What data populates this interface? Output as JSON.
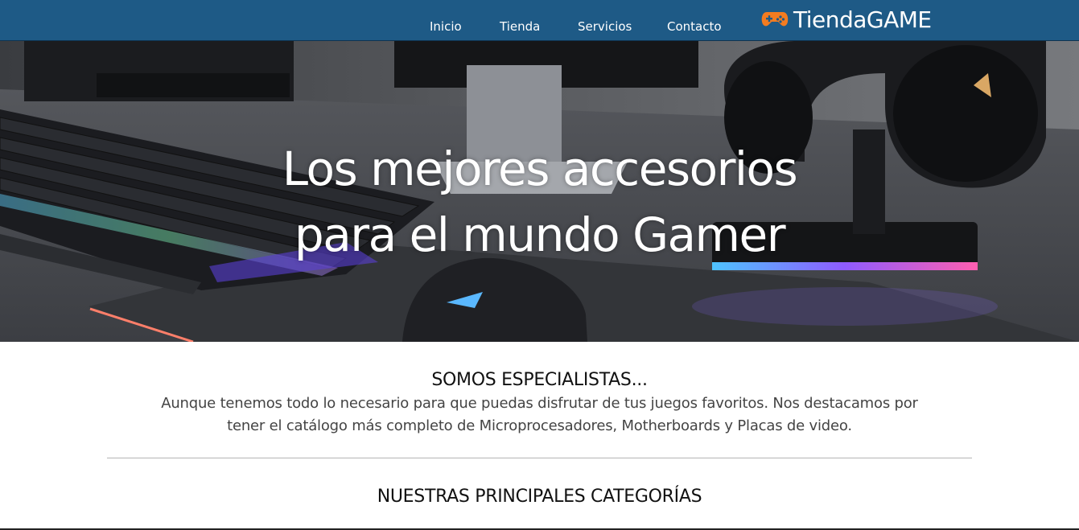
{
  "nav": {
    "links": [
      {
        "label": "Inicio"
      },
      {
        "label": "Tienda"
      },
      {
        "label": "Servicios"
      },
      {
        "label": "Contacto"
      }
    ],
    "brand": {
      "name": "TiendaGAME",
      "icon": "gamepad-icon"
    }
  },
  "hero": {
    "title_line1": "Los mejores accesorios",
    "title_line2": "para el mundo Gamer",
    "image_description_icon": "hero-photo"
  },
  "about": {
    "heading": "SOMOS ESPECIALISTAS...",
    "text": "Aunque tenemos todo lo necesario para que puedas disfrutar de tus juegos favoritos. Nos destacamos por tener el catálogo más completo de Microprocesadores, Motherboards y Placas de video."
  },
  "categories": {
    "heading": "NUESTRAS PRINCIPALES CATEGORÍAS"
  },
  "colors": {
    "navbar": "#1e5a86",
    "brand_icon": "#f47c20",
    "text": "#111111"
  }
}
